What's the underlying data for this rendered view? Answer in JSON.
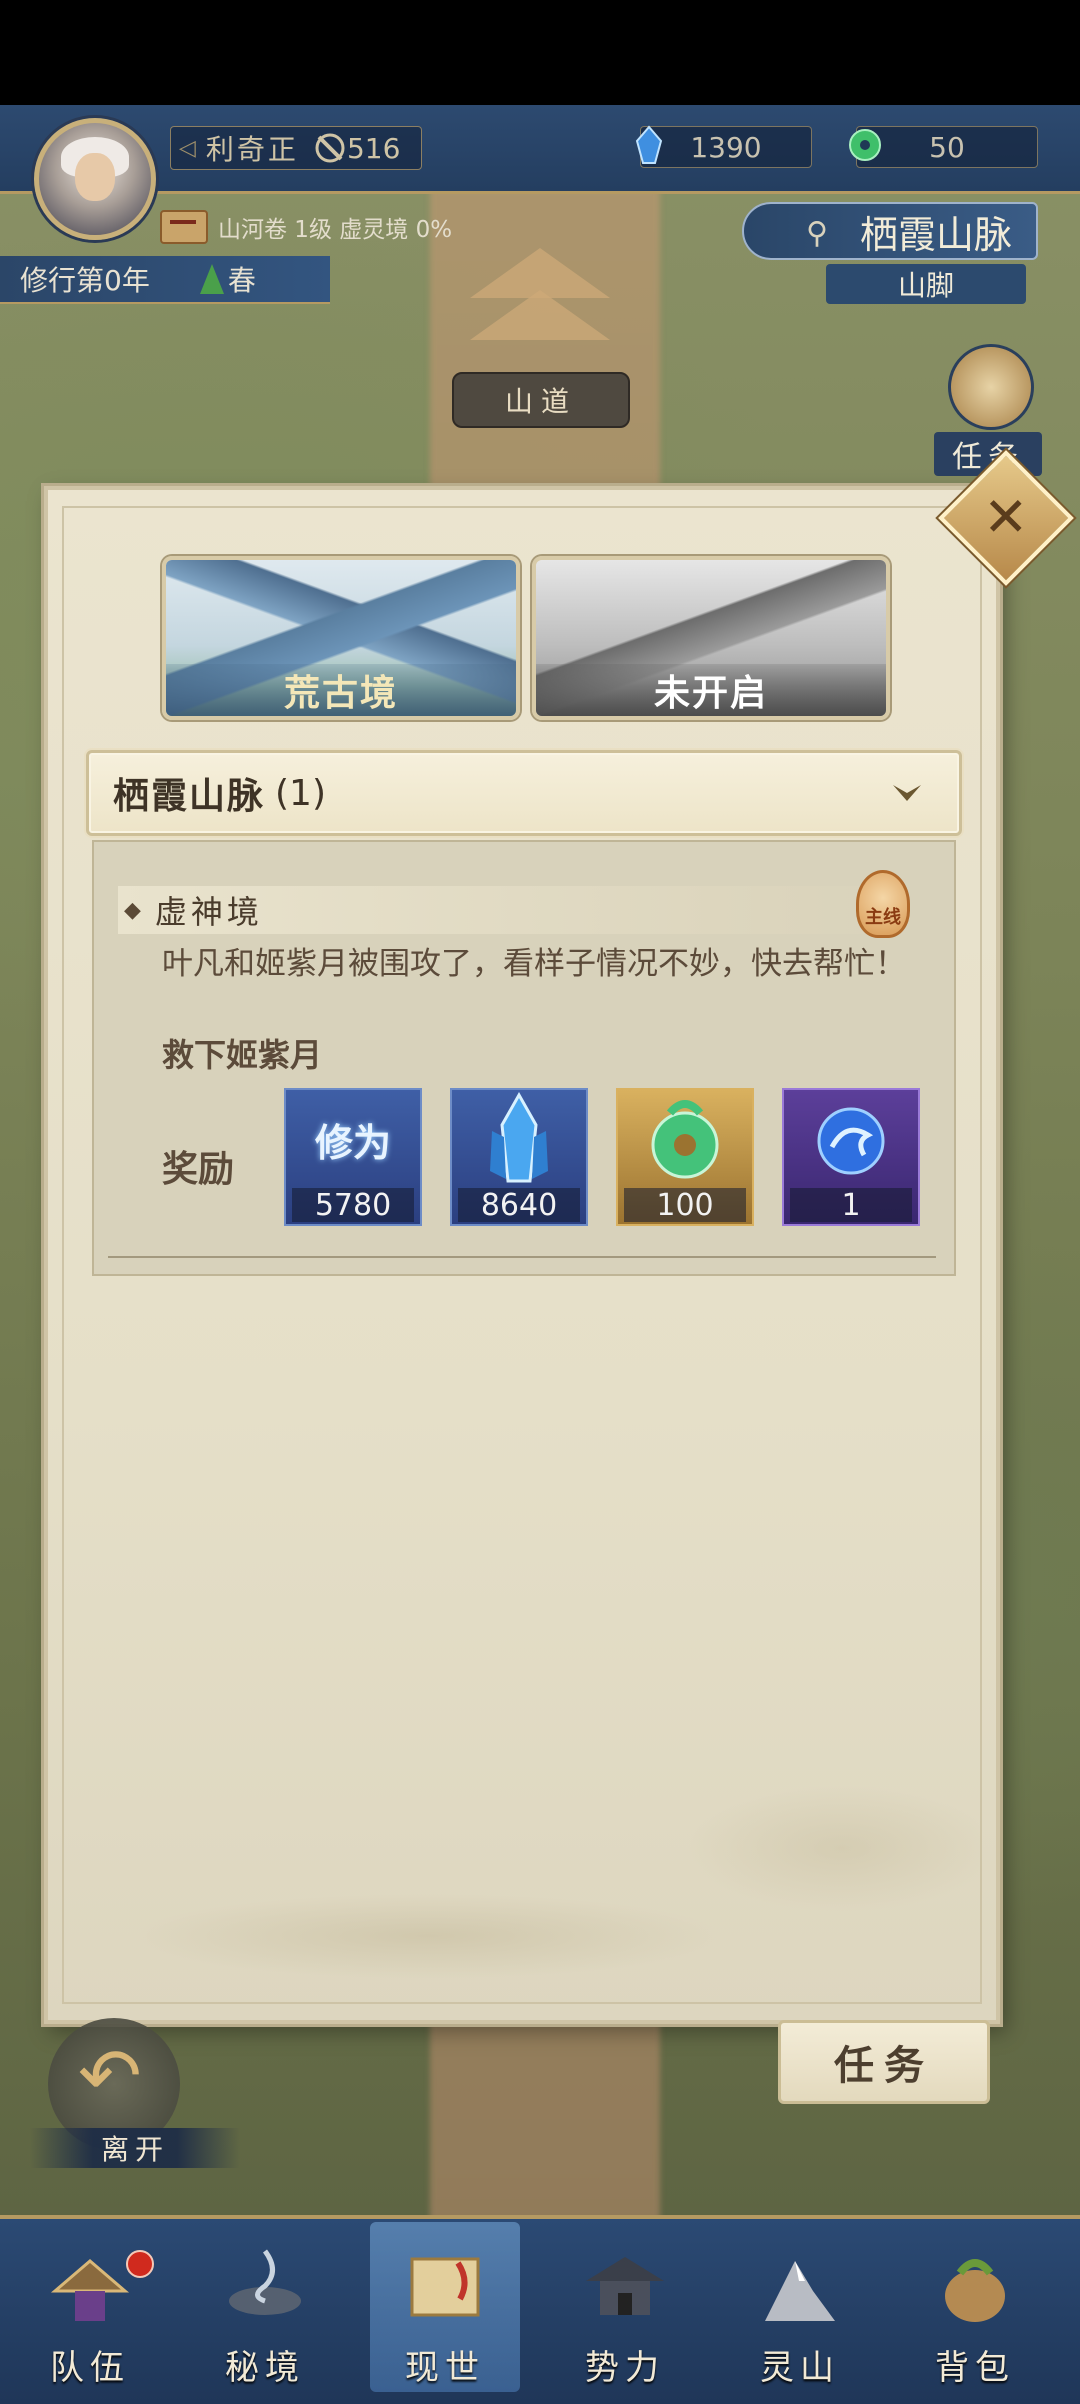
{
  "header": {
    "player_name": "利奇正",
    "combat_power": "516",
    "spirit_stone": "1390",
    "jade": "50",
    "cultivation_info": "山河卷 1级 虚灵境 0%",
    "year_text": "修行第0年",
    "season": "春",
    "location": "栖霞山脉",
    "sub_location": "山脚"
  },
  "map": {
    "road_sign": "山道",
    "task_icon_label": "任务"
  },
  "panel": {
    "tabs": [
      {
        "label": "荒古境"
      },
      {
        "label": "未开启"
      }
    ],
    "region": {
      "name": "栖霞山脉",
      "count": "(1)"
    },
    "quest": {
      "name": "虚神境",
      "badge": "主线",
      "description": "叶凡和姬紫月被围攻了，看样子情况不妙，快去帮忙！",
      "goal": "救下姬紫月",
      "reward_label": "奖励",
      "rewards": [
        {
          "icon": "cultivation-icon",
          "icon_text": "修为",
          "amount": "5780"
        },
        {
          "icon": "crystal-icon",
          "amount": "8640"
        },
        {
          "icon": "jade-icon",
          "amount": "100"
        },
        {
          "icon": "dragon-orb-icon",
          "amount": "1"
        }
      ]
    }
  },
  "controls": {
    "leave_label": "离开",
    "task_button": "任务"
  },
  "nav": {
    "items": [
      {
        "label": "队伍",
        "icon": "team-icon"
      },
      {
        "label": "秘境",
        "icon": "secret-realm-icon"
      },
      {
        "label": "现世",
        "icon": "world-map-icon"
      },
      {
        "label": "势力",
        "icon": "faction-icon"
      },
      {
        "label": "灵山",
        "icon": "spirit-mountain-icon"
      },
      {
        "label": "背包",
        "icon": "backpack-icon"
      }
    ]
  }
}
